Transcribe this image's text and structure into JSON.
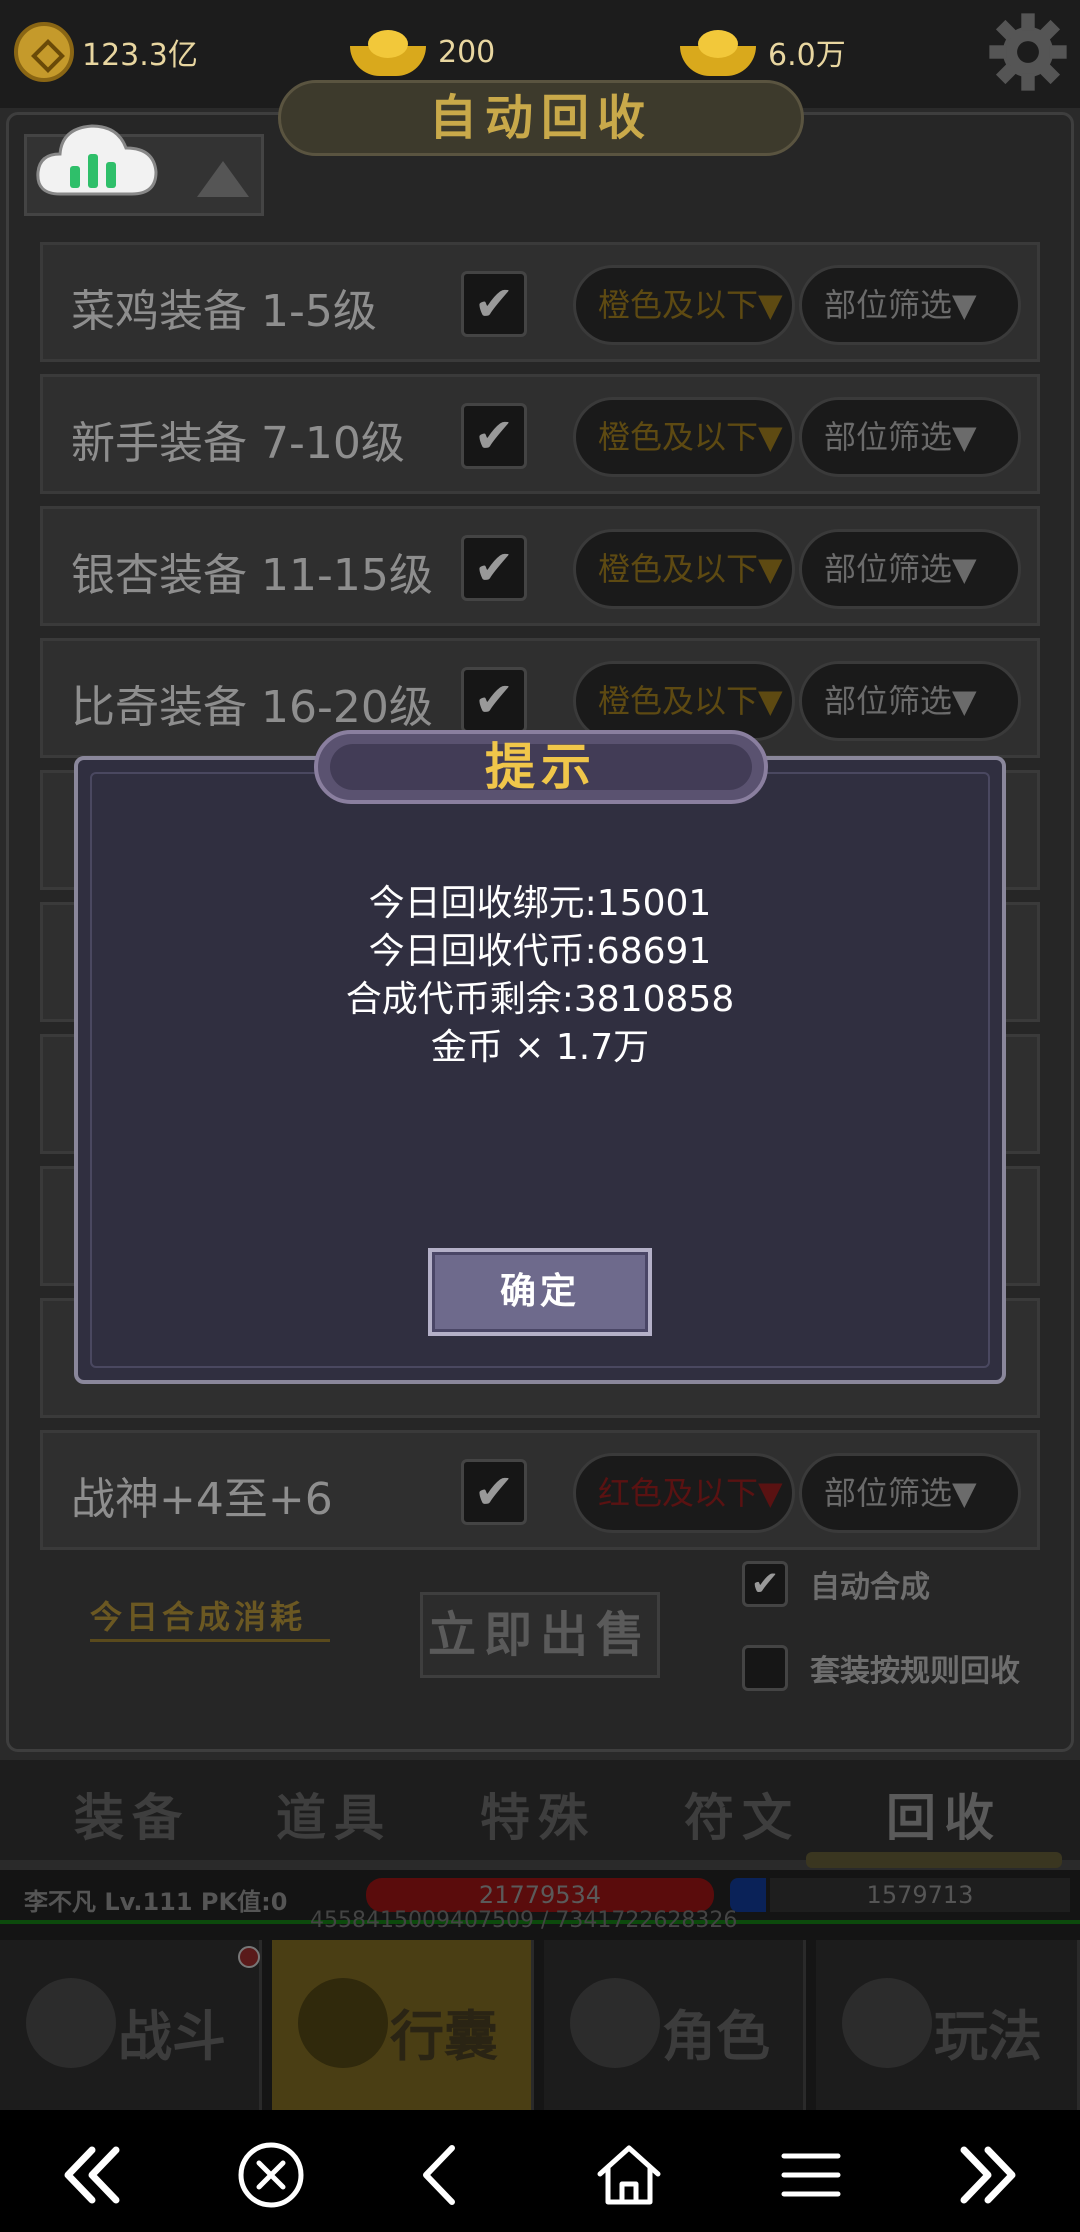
{
  "resources": {
    "copper": "123.3亿",
    "gold_ingot": "200",
    "bound_ingot": "6.0万"
  },
  "header": {
    "title": "自动回收"
  },
  "recycle_rows": [
    {
      "label": "菜鸡装备  1-5级",
      "checked": "✔",
      "quality": "橙色及以下▼",
      "slot": "部位筛选▼"
    },
    {
      "label": "新手装备  7-10级",
      "checked": "✔",
      "quality": "橙色及以下▼",
      "slot": "部位筛选▼"
    },
    {
      "label": "银杏装备 11-15级",
      "checked": "✔",
      "quality": "橙色及以下▼",
      "slot": "部位筛选▼"
    },
    {
      "label": "比奇装备 16-20级",
      "checked": "✔",
      "quality": "橙色及以下▼",
      "slot": "部位筛选▼"
    },
    {
      "label": "战神+4至+6",
      "checked": "✔",
      "quality": "红色及以下▼",
      "slot": "部位筛选▼"
    }
  ],
  "bottom": {
    "consume_label": "今日合成消耗",
    "sell_label": "立即出售",
    "auto_merge": "自动合成",
    "auto_merge_check": "✔",
    "set_rule": "套装按规则回收"
  },
  "tabs": [
    "装备",
    "道具",
    "特殊",
    "符文",
    "回收"
  ],
  "status": {
    "name": "李不凡 Lv.111 PK值:0",
    "hp": "21779534",
    "mp": "1579713",
    "exp": "4558415009407509 / 7341722628326"
  },
  "nav": [
    "战斗",
    "行囊",
    "角色",
    "玩法"
  ],
  "dialog": {
    "title": "提示",
    "lines": [
      "今日回收绑元:15001",
      "今日回收代币:68691",
      "合成代币剩余:3810858",
      "金币 × 1.7万"
    ],
    "ok": "确定"
  },
  "colors": {
    "dialog_bg": "#302f40",
    "title_text": "#f0c64a",
    "button_bg": "#6e6a8c"
  }
}
